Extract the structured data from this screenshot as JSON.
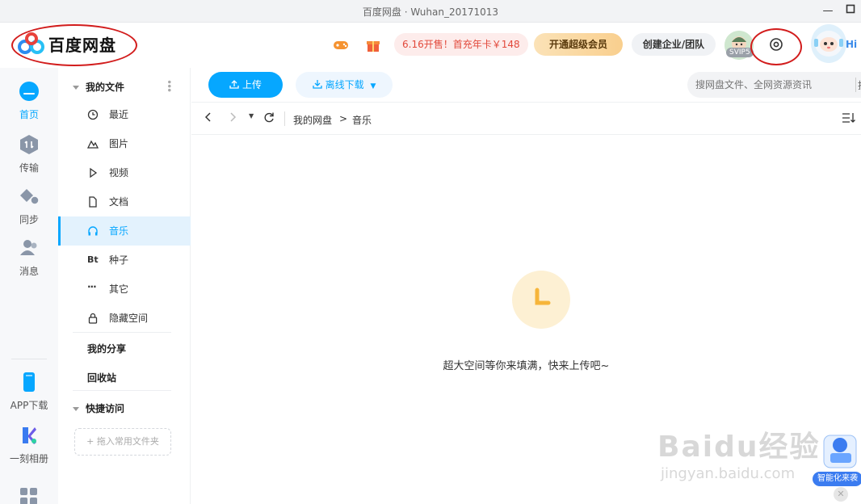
{
  "window": {
    "title": "百度网盘 · Wuhan_20171013"
  },
  "header": {
    "app_name": "百度网盘",
    "promo": "6.16开售！首充年卡￥148",
    "vip_button": "开通超级会员",
    "team_button": "创建企业/团队",
    "svip_tag": "SVIP5",
    "hi_text": "Hi"
  },
  "leftnav": {
    "items": [
      {
        "label": "首页",
        "icon": "home-cloud-icon",
        "active": true
      },
      {
        "label": "传输",
        "icon": "transfer-icon",
        "active": false
      },
      {
        "label": "同步",
        "icon": "sync-icon",
        "active": false
      },
      {
        "label": "消息",
        "icon": "message-icon",
        "active": false
      }
    ],
    "bottom": [
      {
        "label": "APP下载",
        "icon": "phone-icon"
      },
      {
        "label": "一刻相册",
        "icon": "album-icon"
      }
    ]
  },
  "sidebar": {
    "my_files": "我的文件",
    "items": [
      {
        "label": "最近",
        "icon": "clock-icon"
      },
      {
        "label": "图片",
        "icon": "image-icon"
      },
      {
        "label": "视频",
        "icon": "play-icon"
      },
      {
        "label": "文档",
        "icon": "document-icon"
      },
      {
        "label": "音乐",
        "icon": "headphones-icon",
        "active": true
      },
      {
        "label": "种子",
        "icon": "bt-icon"
      },
      {
        "label": "其它",
        "icon": "ellipsis-icon"
      },
      {
        "label": "隐藏空间",
        "icon": "lock-icon"
      }
    ],
    "my_share": "我的分享",
    "recycle": "回收站",
    "quick_access": "快捷访问",
    "dropzone": "+ 拖入常用文件夹"
  },
  "toolbar": {
    "upload": "上传",
    "offline_download": "离线下载",
    "search_placeholder": "搜网盘文件、全网资源资讯",
    "search_tail": "搜"
  },
  "breadcrumb": {
    "root": "我的网盘",
    "separator": ">",
    "current": "音乐"
  },
  "empty_state": {
    "message": "超大空间等你来填满，快来上传吧~"
  },
  "watermark": {
    "brand": "Baidu经验",
    "url": "jingyan.baidu.com"
  },
  "assistant": {
    "tag": "智能化来袭"
  },
  "colors": {
    "accent": "#06a7ff",
    "annotation": "#d21c1c",
    "promo_text": "#e2493b",
    "empty_icon": "#f6b53a"
  }
}
